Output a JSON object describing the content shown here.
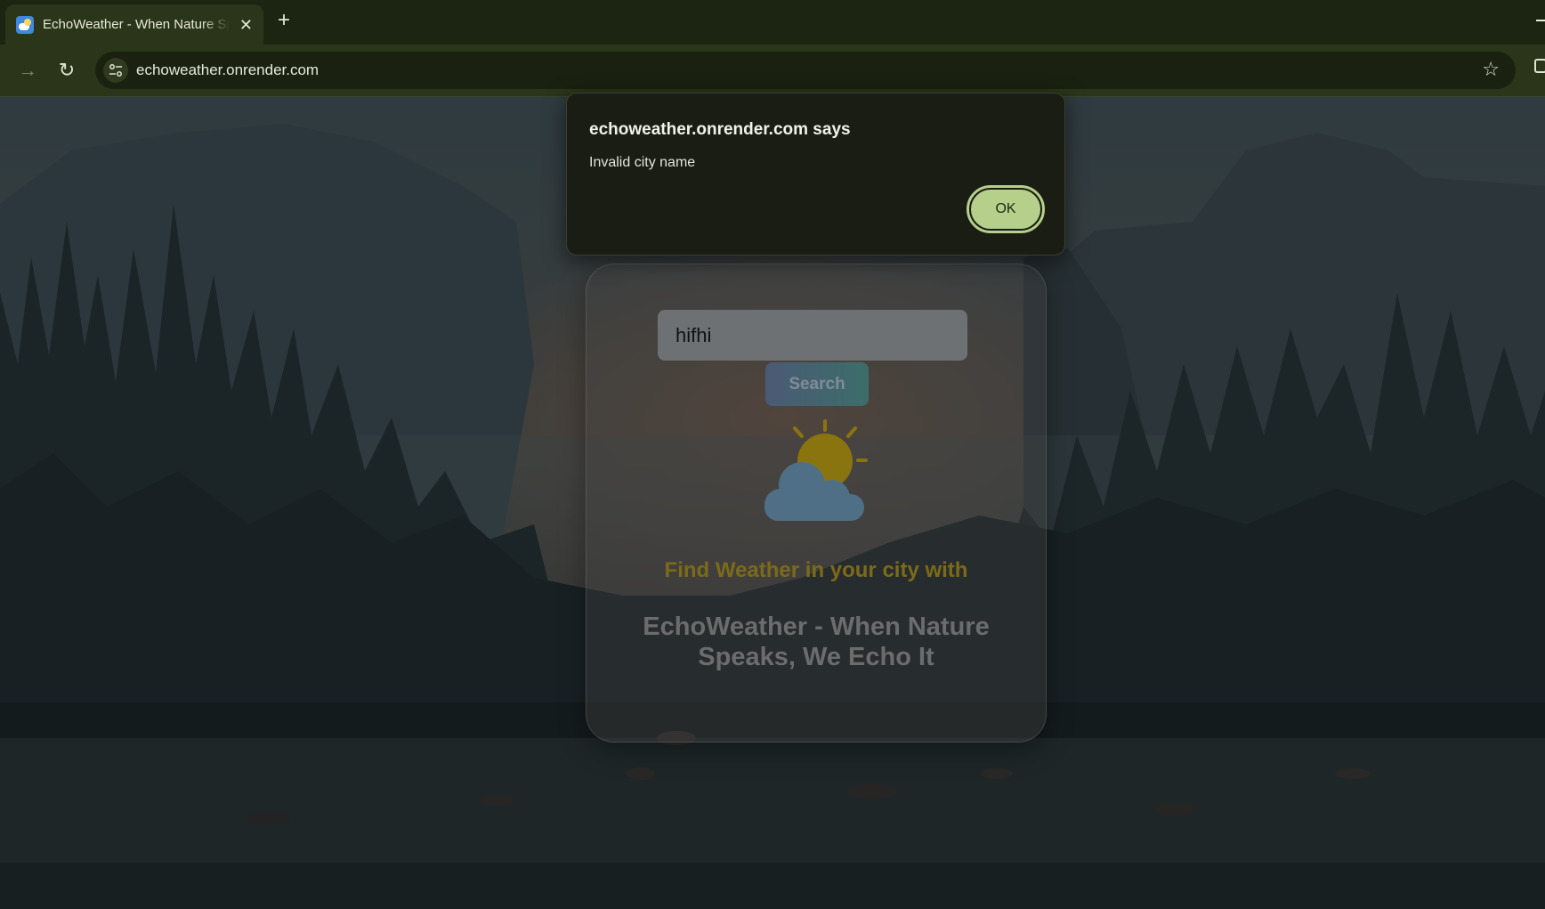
{
  "browser": {
    "tab_title": "EchoWeather - When Nature Speaks, We Echo It",
    "tab_close": "✕",
    "new_tab": "+",
    "url": "echoweather.onrender.com",
    "nav_forward": "→",
    "nav_reload": "↻",
    "star": "☆"
  },
  "dialog": {
    "title": "echoweather.onrender.com says",
    "message": "Invalid city name",
    "ok_label": "OK"
  },
  "app": {
    "search_value": "hifhi",
    "search_button_label": "Search",
    "tagline": "Find Weather in your city with",
    "title": "EchoWeather - When Nature Speaks, We Echo It"
  },
  "colors": {
    "accent_ok": "#b6cf8a",
    "tagline": "#7d6a19",
    "sun": "#8a7410",
    "cloud": "#4f6f86"
  }
}
